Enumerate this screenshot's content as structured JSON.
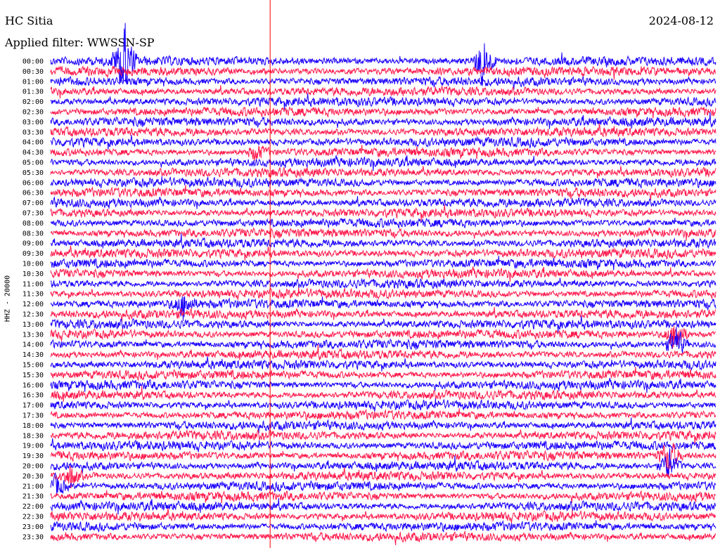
{
  "header": {
    "station": "HC Sitia",
    "date": "2024-08-12",
    "filter": "Applied filter: WWSSN-SP"
  },
  "chart_data": {
    "type": "line",
    "title": "HC Sitia",
    "ylabel": "HHZ - 20000",
    "row_labels": [
      "00:00",
      "00:30",
      "01:00",
      "01:30",
      "02:00",
      "02:30",
      "03:00",
      "03:30",
      "04:00",
      "04:30",
      "05:00",
      "05:30",
      "06:00",
      "06:30",
      "07:00",
      "07:30",
      "08:00",
      "08:30",
      "09:00",
      "09:30",
      "10:00",
      "10:30",
      "11:00",
      "11:30",
      "12:00",
      "12:30",
      "13:00",
      "13:30",
      "14:00",
      "14:30",
      "15:00",
      "15:30",
      "16:00",
      "16:30",
      "17:00",
      "17:30",
      "18:00",
      "18:30",
      "19:00",
      "19:30",
      "20:00",
      "20:30",
      "21:00",
      "21:30",
      "22:00",
      "22:30",
      "23:00",
      "23:30"
    ],
    "trace_colors": [
      "#1a00ff",
      "#ff1a4d"
    ],
    "marker_color": "#ff0000",
    "events": [
      {
        "row": "00:00",
        "position_fraction": 0.11,
        "amplitude": 6.0,
        "color": "#1a00ff"
      },
      {
        "row": "00:00",
        "position_fraction": 0.65,
        "amplitude": 4.0,
        "color": "#ff1a4d"
      },
      {
        "row": "04:30",
        "position_fraction": 0.31,
        "amplitude": 1.2,
        "color": "#1a00ff"
      },
      {
        "row": "12:00",
        "position_fraction": 0.2,
        "amplitude": 2.0,
        "color": "#ff1a4d"
      },
      {
        "row": "13:30",
        "position_fraction": 0.94,
        "amplitude": 3.0,
        "color": "#ff1a4d"
      },
      {
        "row": "14:00",
        "position_fraction": 0.94,
        "amplitude": 2.5,
        "color": "#ff1a4d"
      },
      {
        "row": "19:30",
        "position_fraction": 0.93,
        "amplitude": 2.5,
        "color": "#ff1a4d"
      },
      {
        "row": "20:00",
        "position_fraction": 0.93,
        "amplitude": 2.0,
        "color": "#ff1a4d"
      },
      {
        "row": "20:30",
        "position_fraction": 0.03,
        "amplitude": 1.5,
        "color": "#ff1a4d"
      },
      {
        "row": "21:00",
        "position_fraction": 0.01,
        "amplitude": 1.5,
        "color": "#1a00ff"
      }
    ],
    "minute_marker_fraction": 0.33
  }
}
